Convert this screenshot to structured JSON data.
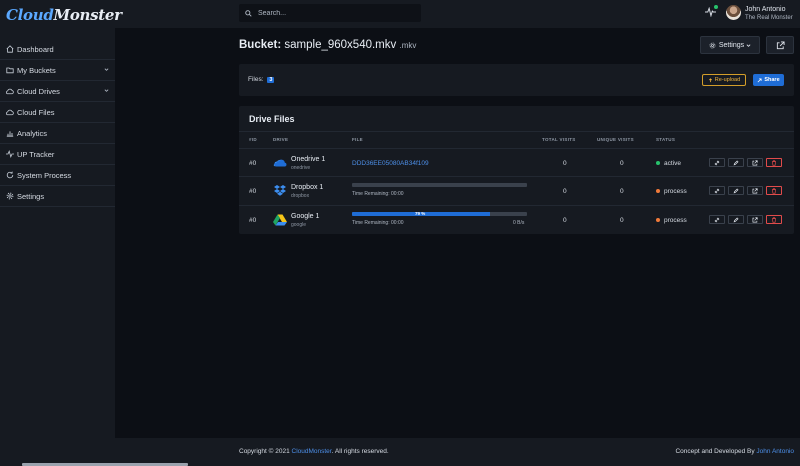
{
  "header": {
    "logo_prefix": "Cloud",
    "logo_suffix": "Monster",
    "search_placeholder": "Search...",
    "user_name": "John Antonio",
    "user_subtitle": "The Real Monster"
  },
  "sidebar": {
    "items": [
      {
        "label": "Dashboard",
        "icon": "home-icon"
      },
      {
        "label": "My Buckets",
        "icon": "folder-icon"
      },
      {
        "label": "Cloud Drives",
        "icon": "cloud-icon"
      },
      {
        "label": "Cloud Files",
        "icon": "cloud-icon"
      },
      {
        "label": "Analytics",
        "icon": "bar-chart-icon"
      },
      {
        "label": "UP Tracker",
        "icon": "activity-icon"
      },
      {
        "label": "System Process",
        "icon": "refresh-icon"
      },
      {
        "label": "Settings",
        "icon": "gear-icon"
      }
    ]
  },
  "page": {
    "title_label": "Bucket:",
    "title_name": "sample_960x540.mkv",
    "title_ext": ".mkv",
    "settings_label": "Settings",
    "files_label": "Files:",
    "files_count": "3",
    "reupload_label": "Re-upload",
    "share_label": "Share"
  },
  "drive_files": {
    "title": "Drive Files",
    "columns": [
      "#ID",
      "DRIVE",
      "FILE",
      "TOTAL VISITS",
      "UNIQUE VISITS",
      "STATUS"
    ],
    "rows": [
      {
        "id": "#0",
        "drive": "Onedrive 1",
        "drive_sub": "onedrive",
        "file": "DDD36EE05080AB34f109",
        "total": "0",
        "unique": "0",
        "status": "active",
        "status_color": "#27c26c"
      },
      {
        "id": "#0",
        "drive": "Dropbox 1",
        "drive_sub": "dropbox",
        "time_remaining": "Time Remaining: 00:00",
        "progress": 0,
        "total": "0",
        "unique": "0",
        "status": "process",
        "status_color": "#f07a3a"
      },
      {
        "id": "#0",
        "drive": "Google 1",
        "drive_sub": "google",
        "progress_label": "79 %",
        "time_remaining": "Time Remaining: 00:00",
        "speed": "0 B/s",
        "progress": 0.79,
        "total": "0",
        "unique": "0",
        "status": "process",
        "status_color": "#f07a3a"
      }
    ]
  },
  "footer": {
    "copyright_prefix": "Copyright © 2021",
    "copyright_brand": "CloudMonster",
    "copyright_suffix": ". All rights reserved.",
    "credit_prefix": "Concept and Developed By",
    "credit_name": "John Antonio"
  }
}
